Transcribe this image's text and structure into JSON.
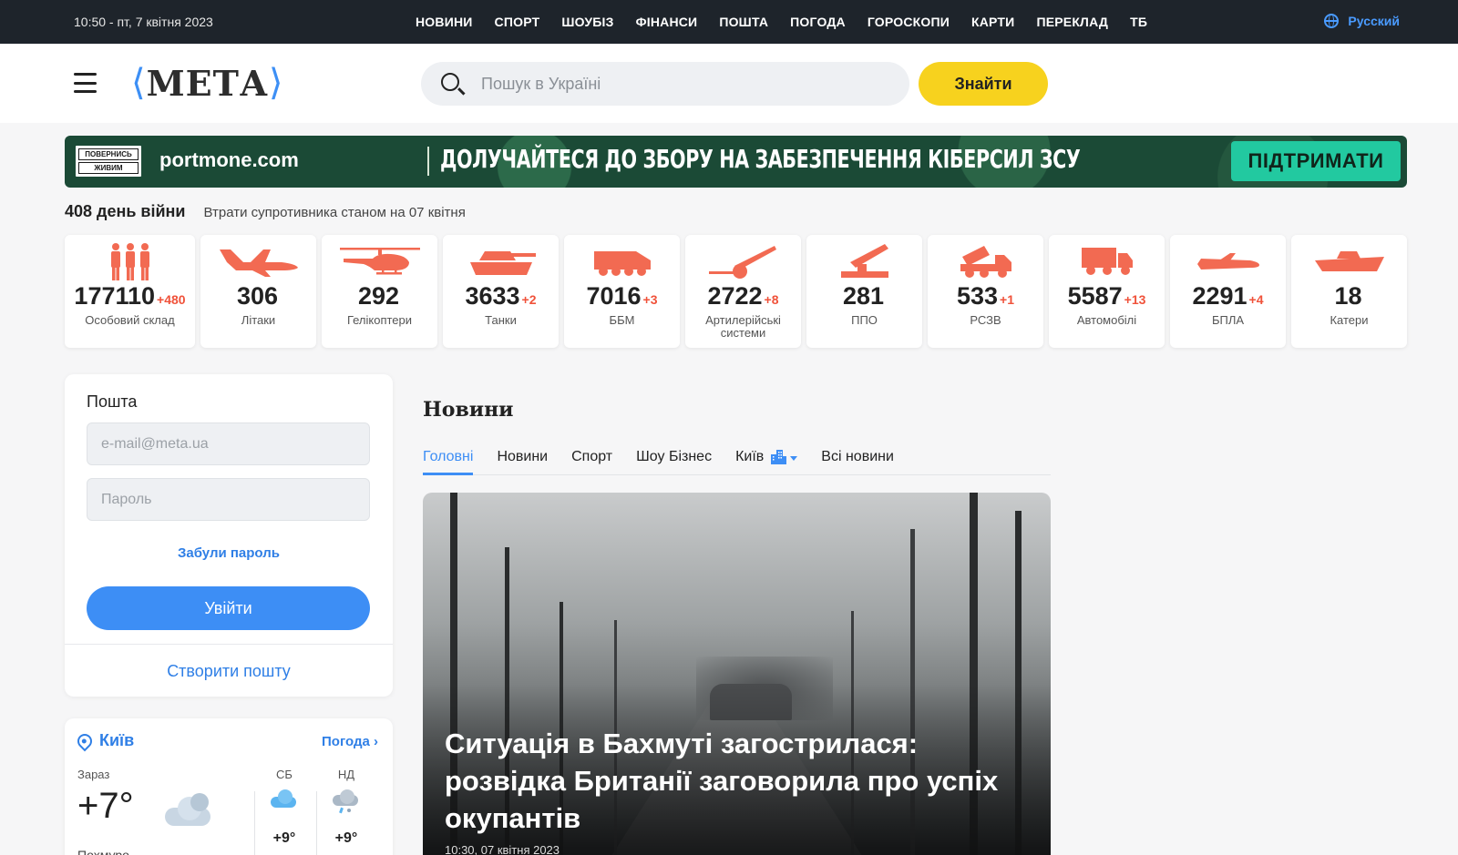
{
  "topbar": {
    "datetime": "10:50 - пт, 7 квітня 2023",
    "nav": [
      "НОВИНИ",
      "СПОРТ",
      "ШОУБІЗ",
      "ФІНАНСИ",
      "ПОШТА",
      "ПОГОДА",
      "ГОРОСКОПИ",
      "КАРТИ",
      "ПЕРЕКЛАД",
      "ТБ"
    ],
    "language": "Русский"
  },
  "header": {
    "logo": "МЕТА",
    "search_placeholder": "Пошук в Україні",
    "search_value": "",
    "find_button": "Знайти"
  },
  "banner": {
    "badge_line1": "ПОВЕРНИСЬ",
    "badge_line2": "ЖИВИМ",
    "brand": "portmone.com",
    "slogan": "ДОЛУЧАЙТЕСЯ ДО ЗБОРУ НА ЗАБЕЗПЕЧЕННЯ КІБЕРСИЛ ЗСУ",
    "button": "ПІДТРИМАТИ"
  },
  "war": {
    "day": "408 день війни",
    "subtitle": "Втрати супротивника станом на 07 квітня",
    "stats": [
      {
        "icon": "personnel-icon",
        "value": "177110",
        "increment": "+480",
        "label": "Особовий склад"
      },
      {
        "icon": "plane-icon",
        "value": "306",
        "increment": "",
        "label": "Літаки"
      },
      {
        "icon": "helicopter-icon",
        "value": "292",
        "increment": "",
        "label": "Гелікоптери"
      },
      {
        "icon": "tank-icon",
        "value": "3633",
        "increment": "+2",
        "label": "Танки"
      },
      {
        "icon": "apc-icon",
        "value": "7016",
        "increment": "+3",
        "label": "ББМ"
      },
      {
        "icon": "artillery-icon",
        "value": "2722",
        "increment": "+8",
        "label": "Артилерійські системи"
      },
      {
        "icon": "air-defense-icon",
        "value": "281",
        "increment": "",
        "label": "ППО"
      },
      {
        "icon": "mlrs-icon",
        "value": "533",
        "increment": "+1",
        "label": "РСЗВ"
      },
      {
        "icon": "truck-icon",
        "value": "5587",
        "increment": "+13",
        "label": "Автомобілі"
      },
      {
        "icon": "drone-icon",
        "value": "2291",
        "increment": "+4",
        "label": "БПЛА"
      },
      {
        "icon": "boat-icon",
        "value": "18",
        "increment": "",
        "label": "Катери"
      }
    ],
    "accent_color": "#f26a52"
  },
  "mail": {
    "title": "Пошта",
    "email_placeholder": "e-mail@meta.ua",
    "password_placeholder": "Пароль",
    "forgot": "Забули пароль",
    "login_button": "Увійти",
    "create": "Створити пошту"
  },
  "weather": {
    "city": "Київ",
    "link": "Погода",
    "now_label": "Зараз",
    "now_temp": "+7°",
    "condition": "Похмуро",
    "days": [
      {
        "label": "СБ",
        "temp": "+9°",
        "icon": "rain-cloud-icon"
      },
      {
        "label": "НД",
        "temp": "+9°",
        "icon": "snow-rain-cloud-icon"
      }
    ]
  },
  "news": {
    "title": "Новини",
    "tabs": [
      "Головні",
      "Новини",
      "Спорт",
      "Шоу Бізнес",
      "Київ",
      "Всі новини"
    ],
    "active_tab": "Головні",
    "hero_headline": "Ситуація в Бахмуті загострилася: розвідка Британії заговорила про успіх окупантів",
    "hero_time": "10:30, 07 квітня 2023"
  },
  "colors": {
    "accent": "#3d8ef5",
    "yellow": "#f7d21e",
    "topbar": "#1e242b"
  }
}
